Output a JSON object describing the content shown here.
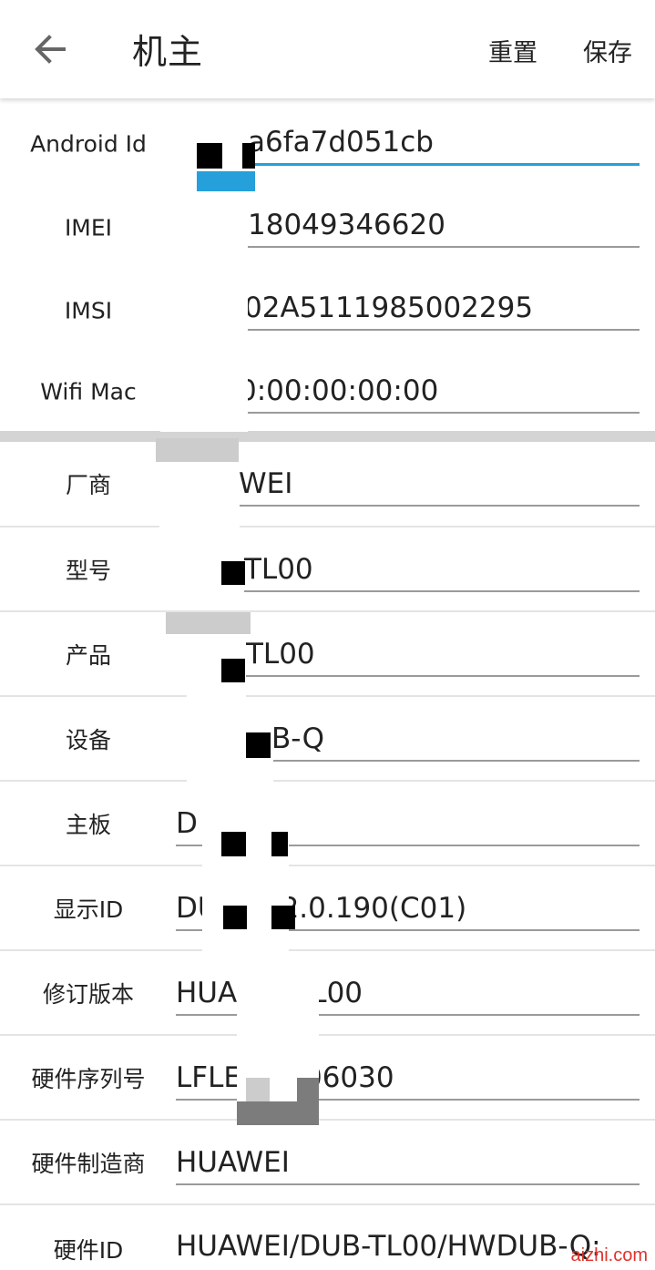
{
  "appbar": {
    "back_icon": "arrow-left-icon",
    "title": "机主",
    "reset_label": "重置",
    "save_label": "保存"
  },
  "identity_fields": [
    {
      "label": "Android Id",
      "value": "a6fa7d051cb",
      "focused": true
    },
    {
      "label": "IMEI",
      "value": "18049346620"
    },
    {
      "label": "IMSI",
      "value": "02A5111985002295"
    },
    {
      "label": "Wifi Mac",
      "value": "0:00:00:00:00"
    }
  ],
  "device_fields": [
    {
      "label": "厂商",
      "value": "WEI"
    },
    {
      "label": "型号",
      "value": "TL00"
    },
    {
      "label": "产品",
      "value": "TL00"
    },
    {
      "label": "设备",
      "value": "B-Q"
    },
    {
      "label": "主板",
      "value": "D        00"
    },
    {
      "label": "显示ID",
      "value": "DU              0 8.2.0.190(C01)"
    },
    {
      "label": "修订版本",
      "value": "HUA          UB-TL00"
    },
    {
      "label": "硬件序列号",
      "value": "LFLE            18206030"
    },
    {
      "label": "硬件制造商",
      "value": "HUAWEI"
    },
    {
      "label": "硬件ID",
      "value": "HUAWEI/DUB-TL00/HWDUB-Q:"
    }
  ],
  "colors": {
    "accent": "#25a0db",
    "underline": "#9a9a9a",
    "section_gap": "#d4d4d4"
  },
  "watermark": "aizhi.com"
}
